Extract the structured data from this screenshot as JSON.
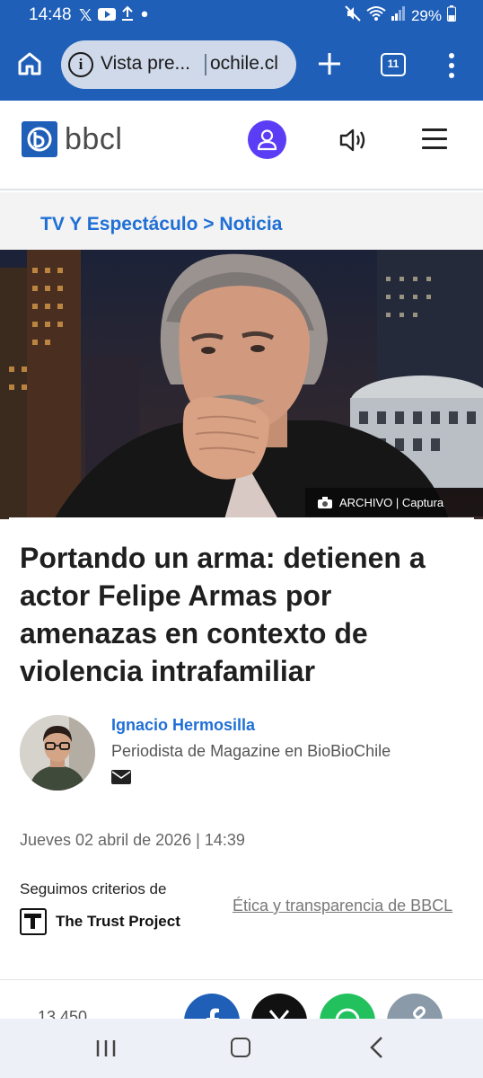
{
  "status_bar": {
    "time": "14:48",
    "battery": "29%"
  },
  "browser": {
    "url_label": "Vista pre...",
    "url_domain": "ochile.cl",
    "tab_count": "11"
  },
  "site": {
    "logo_text": "bbcl",
    "brand_color": "#1f5fb8"
  },
  "breadcrumb": "TV Y Espectáculo > Noticia",
  "image_caption": "ARCHIVO | Captura",
  "headline": "Portando un arma: detienen a actor Felipe Armas por amenazas en contexto de violencia intrafamiliar",
  "author": {
    "name": "Ignacio Hermosilla",
    "role": "Periodista de Magazine en BioBioChile"
  },
  "date": "Jueves 02 abril de 2026 | 14:39",
  "trust": {
    "label": "Seguimos criterios de",
    "project_name": "The Trust Project",
    "ethics_link": "Ética y transparencia de BBCL"
  },
  "share": {
    "count": "13.450"
  }
}
